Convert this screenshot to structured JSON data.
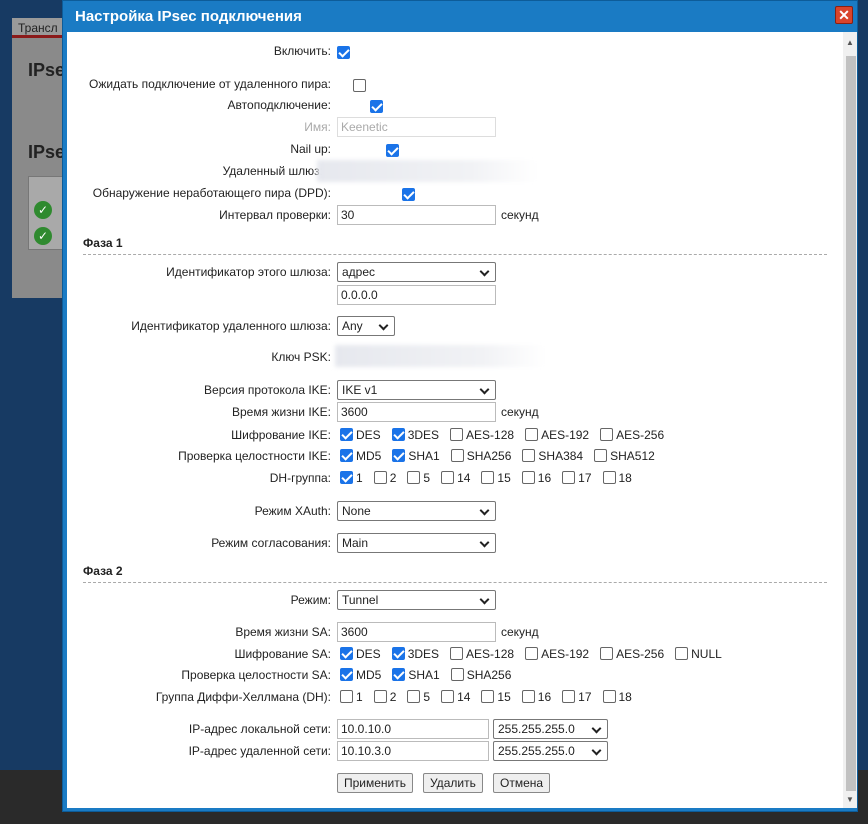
{
  "background": {
    "tab": "Трансл",
    "heading1": "IPse",
    "heading2": "IPse"
  },
  "dialog": {
    "title": "Настройка IPsec подключения"
  },
  "form": {
    "enable": {
      "label": "Включить:",
      "checked": true
    },
    "wait_remote": {
      "label": "Ожидать подключение от удаленного пира:",
      "checked": false
    },
    "autoconnect": {
      "label": "Автоподключение:",
      "checked": true
    },
    "name": {
      "label": "Имя:",
      "value": "Keenetic"
    },
    "nail_up": {
      "label": "Nail up:",
      "checked": true
    },
    "remote_gateway": {
      "label": "Удаленный шлюз:"
    },
    "dpd": {
      "label": "Обнаружение неработающего пира (DPD):",
      "checked": true
    },
    "check_interval": {
      "label": "Интервал проверки:",
      "value": "30",
      "unit": "секунд"
    }
  },
  "phase1": {
    "title": "Фаза 1",
    "local_id": {
      "label": "Идентификатор этого шлюза:",
      "value": "адрес",
      "address": "0.0.0.0"
    },
    "remote_id": {
      "label": "Идентификатор удаленного шлюза:",
      "value": "Any"
    },
    "psk": {
      "label": "Ключ PSK:"
    },
    "ike_version": {
      "label": "Версия протокола IKE:",
      "value": "IKE v1"
    },
    "ike_lifetime": {
      "label": "Время жизни IKE:",
      "value": "3600",
      "unit": "секунд"
    },
    "ike_encryption": {
      "label": "Шифрование IKE:",
      "options": [
        {
          "name": "DES",
          "checked": true
        },
        {
          "name": "3DES",
          "checked": true
        },
        {
          "name": "AES-128",
          "checked": false
        },
        {
          "name": "AES-192",
          "checked": false
        },
        {
          "name": "AES-256",
          "checked": false
        }
      ]
    },
    "ike_integrity": {
      "label": "Проверка целостности IKE:",
      "options": [
        {
          "name": "MD5",
          "checked": true
        },
        {
          "name": "SHA1",
          "checked": true
        },
        {
          "name": "SHA256",
          "checked": false
        },
        {
          "name": "SHA384",
          "checked": false
        },
        {
          "name": "SHA512",
          "checked": false
        }
      ]
    },
    "dh_group": {
      "label": "DH-группа:",
      "options": [
        {
          "name": "1",
          "checked": true
        },
        {
          "name": "2",
          "checked": false
        },
        {
          "name": "5",
          "checked": false
        },
        {
          "name": "14",
          "checked": false
        },
        {
          "name": "15",
          "checked": false
        },
        {
          "name": "16",
          "checked": false
        },
        {
          "name": "17",
          "checked": false
        },
        {
          "name": "18",
          "checked": false
        }
      ]
    },
    "xauth": {
      "label": "Режим XAuth:",
      "value": "None"
    },
    "negotiation": {
      "label": "Режим согласования:",
      "value": "Main"
    }
  },
  "phase2": {
    "title": "Фаза 2",
    "mode": {
      "label": "Режим:",
      "value": "Tunnel"
    },
    "sa_lifetime": {
      "label": "Время жизни SA:",
      "value": "3600",
      "unit": "секунд"
    },
    "sa_encryption": {
      "label": "Шифрование SA:",
      "options": [
        {
          "name": "DES",
          "checked": true
        },
        {
          "name": "3DES",
          "checked": true
        },
        {
          "name": "AES-128",
          "checked": false
        },
        {
          "name": "AES-192",
          "checked": false
        },
        {
          "name": "AES-256",
          "checked": false
        },
        {
          "name": "NULL",
          "checked": false
        }
      ]
    },
    "sa_integrity": {
      "label": "Проверка целостности SA:",
      "options": [
        {
          "name": "MD5",
          "checked": true
        },
        {
          "name": "SHA1",
          "checked": true
        },
        {
          "name": "SHA256",
          "checked": false
        }
      ]
    },
    "dh_group": {
      "label": "Группа Диффи-Хеллмана (DH):",
      "options": [
        {
          "name": "1",
          "checked": false
        },
        {
          "name": "2",
          "checked": false
        },
        {
          "name": "5",
          "checked": false
        },
        {
          "name": "14",
          "checked": false
        },
        {
          "name": "15",
          "checked": false
        },
        {
          "name": "16",
          "checked": false
        },
        {
          "name": "17",
          "checked": false
        },
        {
          "name": "18",
          "checked": false
        }
      ]
    },
    "local_net": {
      "label": "IP-адрес локальной сети:",
      "ip": "10.0.10.0",
      "mask": "255.255.255.0"
    },
    "remote_net": {
      "label": "IP-адрес удаленной сети:",
      "ip": "10.10.3.0",
      "mask": "255.255.255.0"
    }
  },
  "buttons": {
    "apply": "Применить",
    "delete": "Удалить",
    "cancel": "Отмена"
  }
}
